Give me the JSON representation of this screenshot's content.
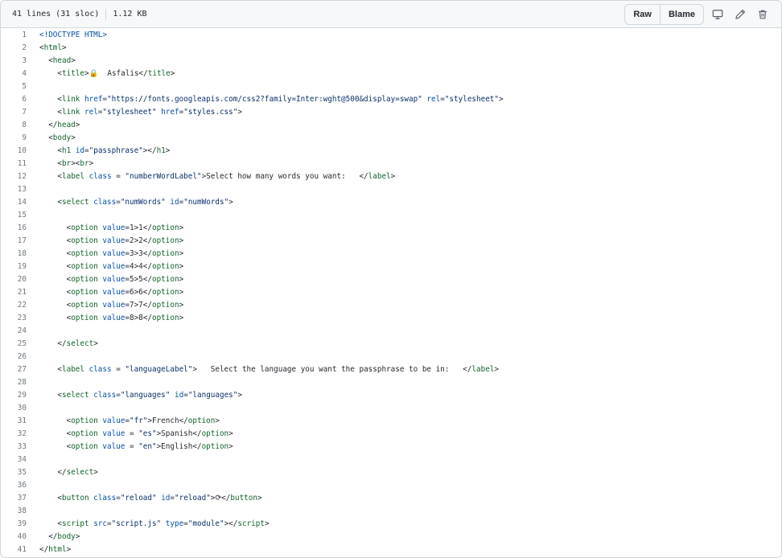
{
  "file_header": {
    "lines_info": "41 lines (31 sloc)",
    "size": "1.12 KB",
    "raw_label": "Raw",
    "blame_label": "Blame",
    "icons": [
      "desktop-icon",
      "pencil-icon",
      "trash-icon"
    ]
  },
  "code_lines": [
    [
      [
        "d",
        "<!DOCTYPE HTML>"
      ]
    ],
    [
      [
        "p",
        "<"
      ],
      [
        "t",
        "html"
      ],
      [
        "p",
        ">"
      ]
    ],
    [
      [
        "p",
        "  <"
      ],
      [
        "t",
        "head"
      ],
      [
        "p",
        ">"
      ]
    ],
    [
      [
        "p",
        "    <"
      ],
      [
        "t",
        "title"
      ],
      [
        "p",
        ">🔒  Asfalis</"
      ],
      [
        "t",
        "title"
      ],
      [
        "p",
        ">"
      ]
    ],
    [],
    [
      [
        "p",
        "    <"
      ],
      [
        "t",
        "link"
      ],
      [
        "p",
        " "
      ],
      [
        "a",
        "href"
      ],
      [
        "p",
        "="
      ],
      [
        "s",
        "\"https://fonts.googleapis.com/css2?family=Inter:wght@500&display=swap\""
      ],
      [
        "p",
        " "
      ],
      [
        "a",
        "rel"
      ],
      [
        "p",
        "="
      ],
      [
        "s",
        "\"stylesheet\""
      ],
      [
        "p",
        ">"
      ]
    ],
    [
      [
        "p",
        "    <"
      ],
      [
        "t",
        "link"
      ],
      [
        "p",
        " "
      ],
      [
        "a",
        "rel"
      ],
      [
        "p",
        "="
      ],
      [
        "s",
        "\"stylesheet\""
      ],
      [
        "p",
        " "
      ],
      [
        "a",
        "href"
      ],
      [
        "p",
        "="
      ],
      [
        "s",
        "\"styles.css\""
      ],
      [
        "p",
        ">"
      ]
    ],
    [
      [
        "p",
        "  </"
      ],
      [
        "t",
        "head"
      ],
      [
        "p",
        ">"
      ]
    ],
    [
      [
        "p",
        "  <"
      ],
      [
        "t",
        "body"
      ],
      [
        "p",
        ">"
      ]
    ],
    [
      [
        "p",
        "    <"
      ],
      [
        "t",
        "h1"
      ],
      [
        "p",
        " "
      ],
      [
        "a",
        "id"
      ],
      [
        "p",
        "="
      ],
      [
        "s",
        "\"passphrase\""
      ],
      [
        "p",
        "></"
      ],
      [
        "t",
        "h1"
      ],
      [
        "p",
        ">"
      ]
    ],
    [
      [
        "p",
        "    <"
      ],
      [
        "t",
        "br"
      ],
      [
        "p",
        "><"
      ],
      [
        "t",
        "br"
      ],
      [
        "p",
        ">"
      ]
    ],
    [
      [
        "p",
        "    <"
      ],
      [
        "t",
        "label"
      ],
      [
        "p",
        " "
      ],
      [
        "a",
        "class"
      ],
      [
        "p",
        " = "
      ],
      [
        "s",
        "\"numberWordLabel\""
      ],
      [
        "p",
        ">Select how many words you want:   </"
      ],
      [
        "t",
        "label"
      ],
      [
        "p",
        ">"
      ]
    ],
    [],
    [
      [
        "p",
        "    <"
      ],
      [
        "t",
        "select"
      ],
      [
        "p",
        " "
      ],
      [
        "a",
        "class"
      ],
      [
        "p",
        "="
      ],
      [
        "s",
        "\"numWords\""
      ],
      [
        "p",
        " "
      ],
      [
        "a",
        "id"
      ],
      [
        "p",
        "="
      ],
      [
        "s",
        "\"numWords\""
      ],
      [
        "p",
        ">"
      ]
    ],
    [],
    [
      [
        "p",
        "      <"
      ],
      [
        "t",
        "option"
      ],
      [
        "p",
        " "
      ],
      [
        "a",
        "value"
      ],
      [
        "p",
        "=1>1</"
      ],
      [
        "t",
        "option"
      ],
      [
        "p",
        ">"
      ]
    ],
    [
      [
        "p",
        "      <"
      ],
      [
        "t",
        "option"
      ],
      [
        "p",
        " "
      ],
      [
        "a",
        "value"
      ],
      [
        "p",
        "=2>2</"
      ],
      [
        "t",
        "option"
      ],
      [
        "p",
        ">"
      ]
    ],
    [
      [
        "p",
        "      <"
      ],
      [
        "t",
        "option"
      ],
      [
        "p",
        " "
      ],
      [
        "a",
        "value"
      ],
      [
        "p",
        "=3>3</"
      ],
      [
        "t",
        "option"
      ],
      [
        "p",
        ">"
      ]
    ],
    [
      [
        "p",
        "      <"
      ],
      [
        "t",
        "option"
      ],
      [
        "p",
        " "
      ],
      [
        "a",
        "value"
      ],
      [
        "p",
        "=4>4</"
      ],
      [
        "t",
        "option"
      ],
      [
        "p",
        ">"
      ]
    ],
    [
      [
        "p",
        "      <"
      ],
      [
        "t",
        "option"
      ],
      [
        "p",
        " "
      ],
      [
        "a",
        "value"
      ],
      [
        "p",
        "=5>5</"
      ],
      [
        "t",
        "option"
      ],
      [
        "p",
        ">"
      ]
    ],
    [
      [
        "p",
        "      <"
      ],
      [
        "t",
        "option"
      ],
      [
        "p",
        " "
      ],
      [
        "a",
        "value"
      ],
      [
        "p",
        "=6>6</"
      ],
      [
        "t",
        "option"
      ],
      [
        "p",
        ">"
      ]
    ],
    [
      [
        "p",
        "      <"
      ],
      [
        "t",
        "option"
      ],
      [
        "p",
        " "
      ],
      [
        "a",
        "value"
      ],
      [
        "p",
        "=7>7</"
      ],
      [
        "t",
        "option"
      ],
      [
        "p",
        ">"
      ]
    ],
    [
      [
        "p",
        "      <"
      ],
      [
        "t",
        "option"
      ],
      [
        "p",
        " "
      ],
      [
        "a",
        "value"
      ],
      [
        "p",
        "=8>8</"
      ],
      [
        "t",
        "option"
      ],
      [
        "p",
        ">"
      ]
    ],
    [],
    [
      [
        "p",
        "    </"
      ],
      [
        "t",
        "select"
      ],
      [
        "p",
        ">"
      ]
    ],
    [],
    [
      [
        "p",
        "    <"
      ],
      [
        "t",
        "label"
      ],
      [
        "p",
        " "
      ],
      [
        "a",
        "class"
      ],
      [
        "p",
        " = "
      ],
      [
        "s",
        "\"languageLabel\""
      ],
      [
        "p",
        ">   Select the language you want the passphrase to be in:   </"
      ],
      [
        "t",
        "label"
      ],
      [
        "p",
        ">"
      ]
    ],
    [],
    [
      [
        "p",
        "    <"
      ],
      [
        "t",
        "select"
      ],
      [
        "p",
        " "
      ],
      [
        "a",
        "class"
      ],
      [
        "p",
        "="
      ],
      [
        "s",
        "\"languages\""
      ],
      [
        "p",
        " "
      ],
      [
        "a",
        "id"
      ],
      [
        "p",
        "="
      ],
      [
        "s",
        "\"languages\""
      ],
      [
        "p",
        ">"
      ]
    ],
    [],
    [
      [
        "p",
        "      <"
      ],
      [
        "t",
        "option"
      ],
      [
        "p",
        " "
      ],
      [
        "a",
        "value"
      ],
      [
        "p",
        "="
      ],
      [
        "s",
        "\"fr\""
      ],
      [
        "p",
        ">French</"
      ],
      [
        "t",
        "option"
      ],
      [
        "p",
        ">"
      ]
    ],
    [
      [
        "p",
        "      <"
      ],
      [
        "t",
        "option"
      ],
      [
        "p",
        " "
      ],
      [
        "a",
        "value"
      ],
      [
        "p",
        " = "
      ],
      [
        "s",
        "\"es\""
      ],
      [
        "p",
        ">Spanish</"
      ],
      [
        "t",
        "option"
      ],
      [
        "p",
        ">"
      ]
    ],
    [
      [
        "p",
        "      <"
      ],
      [
        "t",
        "option"
      ],
      [
        "p",
        " "
      ],
      [
        "a",
        "value"
      ],
      [
        "p",
        " = "
      ],
      [
        "s",
        "\"en\""
      ],
      [
        "p",
        ">English</"
      ],
      [
        "t",
        "option"
      ],
      [
        "p",
        ">"
      ]
    ],
    [],
    [
      [
        "p",
        "    </"
      ],
      [
        "t",
        "select"
      ],
      [
        "p",
        ">"
      ]
    ],
    [],
    [
      [
        "p",
        "    <"
      ],
      [
        "t",
        "button"
      ],
      [
        "p",
        " "
      ],
      [
        "a",
        "class"
      ],
      [
        "p",
        "="
      ],
      [
        "s",
        "\"reload\""
      ],
      [
        "p",
        " "
      ],
      [
        "a",
        "id"
      ],
      [
        "p",
        "="
      ],
      [
        "s",
        "\"reload\""
      ],
      [
        "p",
        ">⟳</"
      ],
      [
        "t",
        "button"
      ],
      [
        "p",
        ">"
      ]
    ],
    [],
    [
      [
        "p",
        "    <"
      ],
      [
        "t",
        "script"
      ],
      [
        "p",
        " "
      ],
      [
        "a",
        "src"
      ],
      [
        "p",
        "="
      ],
      [
        "s",
        "\"script.js\""
      ],
      [
        "p",
        " "
      ],
      [
        "a",
        "type"
      ],
      [
        "p",
        "="
      ],
      [
        "s",
        "\"module\""
      ],
      [
        "p",
        "></"
      ],
      [
        "t",
        "script"
      ],
      [
        "p",
        ">"
      ]
    ],
    [
      [
        "p",
        "  </"
      ],
      [
        "t",
        "body"
      ],
      [
        "p",
        ">"
      ]
    ],
    [
      [
        "p",
        "</"
      ],
      [
        "t",
        "html"
      ],
      [
        "p",
        ">"
      ]
    ]
  ]
}
